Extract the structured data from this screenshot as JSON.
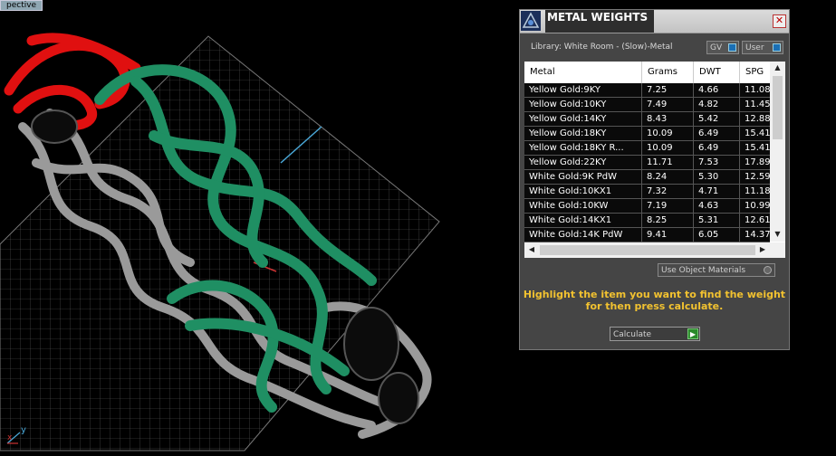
{
  "viewport": {
    "view_label": "pective",
    "axis_y": "y",
    "axis_x": "x"
  },
  "panel": {
    "title": "METAL WEIGHTS",
    "close_glyph": "✕",
    "library": "Library: White Room - (Slow)-Metal",
    "gv_label": "GV",
    "user_label": "User",
    "columns": [
      "Metal",
      "Grams",
      "DWT",
      "SPG"
    ],
    "rows": [
      {
        "metal": "Yellow Gold:9KY",
        "grams": "7.25",
        "dwt": "4.66",
        "spg": "11.08"
      },
      {
        "metal": "Yellow Gold:10KY",
        "grams": "7.49",
        "dwt": "4.82",
        "spg": "11.45"
      },
      {
        "metal": "Yellow Gold:14KY",
        "grams": "8.43",
        "dwt": "5.42",
        "spg": "12.88"
      },
      {
        "metal": "Yellow Gold:18KY",
        "grams": "10.09",
        "dwt": "6.49",
        "spg": "15.41"
      },
      {
        "metal": "Yellow Gold:18KY R...",
        "grams": "10.09",
        "dwt": "6.49",
        "spg": "15.41"
      },
      {
        "metal": "Yellow Gold:22KY",
        "grams": "11.71",
        "dwt": "7.53",
        "spg": "17.89"
      },
      {
        "metal": "White Gold:9K PdW",
        "grams": "8.24",
        "dwt": "5.30",
        "spg": "12.59"
      },
      {
        "metal": "White Gold:10KX1",
        "grams": "7.32",
        "dwt": "4.71",
        "spg": "11.18"
      },
      {
        "metal": "White Gold:10KW",
        "grams": "7.19",
        "dwt": "4.63",
        "spg": "10.99"
      },
      {
        "metal": "White Gold:14KX1",
        "grams": "8.25",
        "dwt": "5.31",
        "spg": "12.61"
      },
      {
        "metal": "White Gold:14K PdW",
        "grams": "9.41",
        "dwt": "6.05",
        "spg": "14.37"
      }
    ],
    "use_object_materials": "Use Object Materials",
    "instruction_line1": "Highlight the item you want to find the weight",
    "instruction_line2": "for then press calculate.",
    "calculate_label": "Calculate",
    "colors": {
      "accent_text": "#f2c230",
      "selection_blue": "#1a6fb5"
    }
  }
}
